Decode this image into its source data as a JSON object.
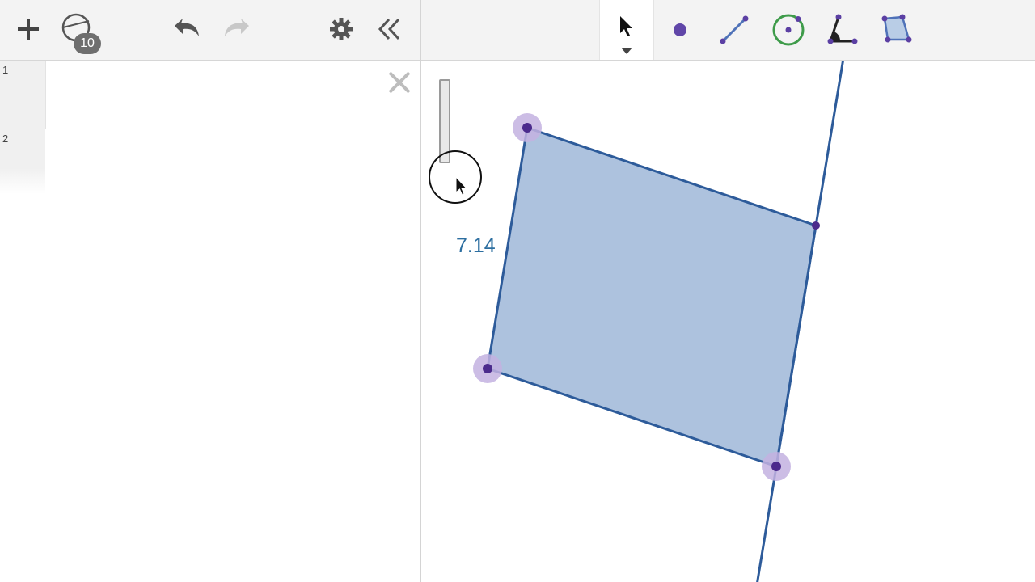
{
  "toolbar_left": {
    "add_icon": "plus-icon",
    "construction_icon": "construction-protocol-icon",
    "construction_badge": "10",
    "undo_icon": "undo-icon",
    "redo_icon": "redo-icon",
    "settings_icon": "gear-icon",
    "collapse_icon": "double-chevron-left-icon"
  },
  "algebra_view": {
    "rows": [
      {
        "number": "1",
        "content": ""
      },
      {
        "number": "2",
        "content": ""
      }
    ],
    "close_icon": "close-icon"
  },
  "toolbar_right": {
    "tools": [
      {
        "name": "move",
        "icon": "cursor-arrow-icon",
        "active": true
      },
      {
        "name": "point",
        "icon": "point-icon"
      },
      {
        "name": "segment",
        "icon": "segment-icon"
      },
      {
        "name": "circle",
        "icon": "circle-center-point-icon"
      },
      {
        "name": "angle",
        "icon": "angle-icon"
      },
      {
        "name": "polygon",
        "icon": "polygon-icon"
      }
    ]
  },
  "graphics": {
    "measurement_label": "7.14"
  },
  "colors": {
    "polygon_fill": "#a9bfdc",
    "polygon_stroke": "#2d5b9a",
    "point": "#4b2a8c",
    "point_halo": "#c3b1e1",
    "label": "#2c6ea0"
  }
}
